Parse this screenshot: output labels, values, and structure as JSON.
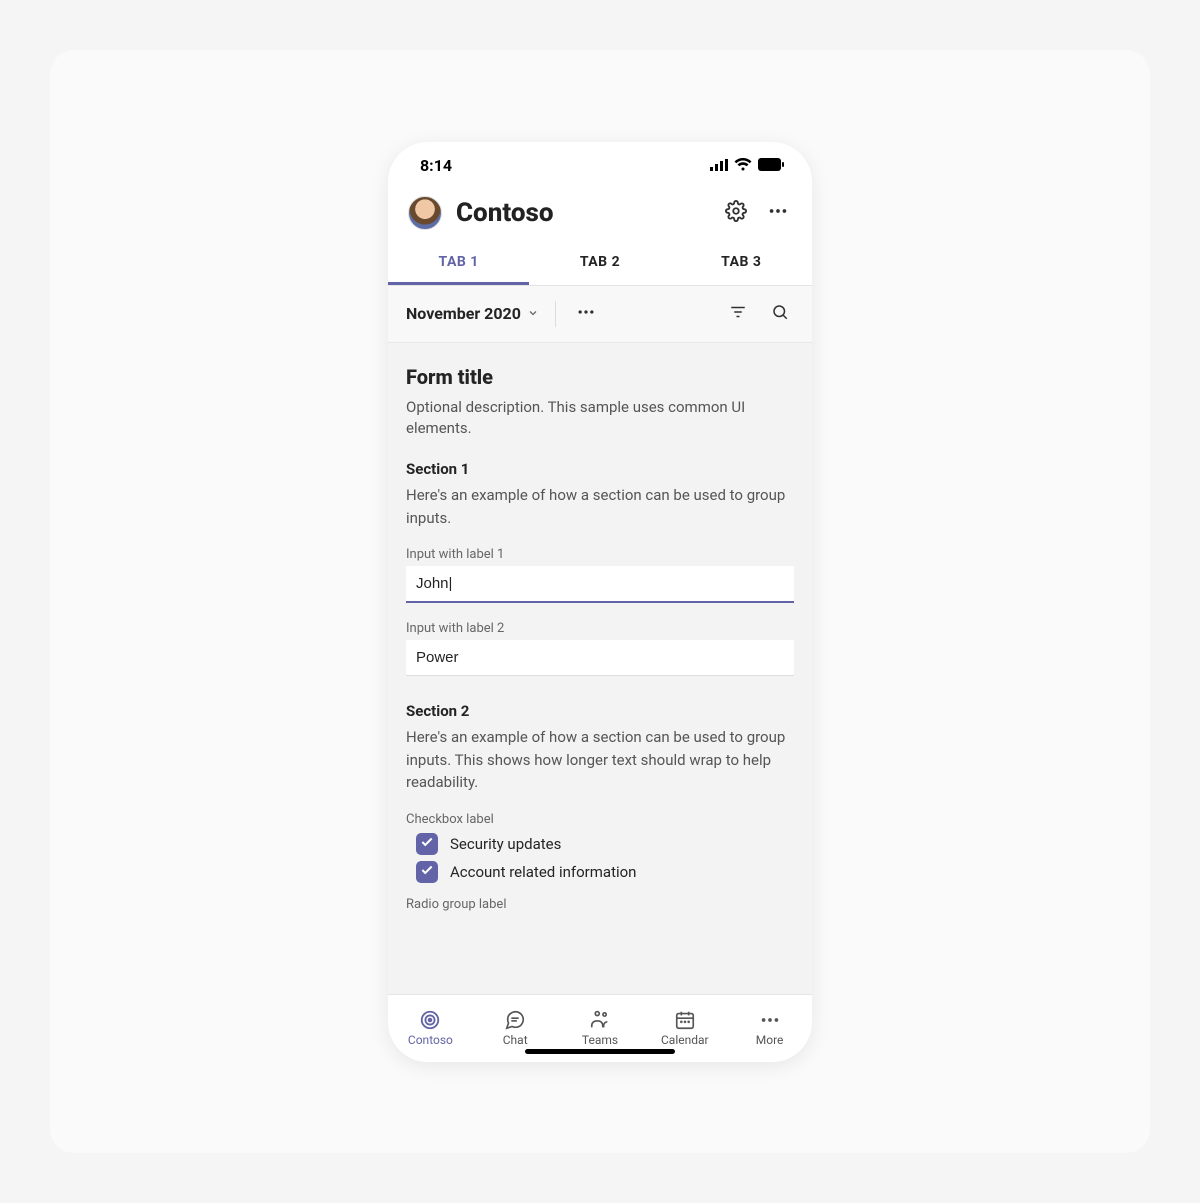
{
  "status": {
    "time": "8:14"
  },
  "header": {
    "app_title": "Contoso"
  },
  "tabs": [
    "TAB 1",
    "TAB 2",
    "TAB 3"
  ],
  "subheader": {
    "month": "November 2020"
  },
  "form": {
    "title": "Form title",
    "description": "Optional description. This sample uses common UI elements.",
    "section1": {
      "title": "Section 1",
      "description": "Here's an example of how a section can be used to group inputs.",
      "input1_label": "Input with label 1",
      "input1_value": "John|",
      "input2_label": "Input with label 2",
      "input2_value": "Power"
    },
    "section2": {
      "title": "Section 2",
      "description": "Here's an example of how a section can be used to group inputs. This shows how longer text should wrap to help readability.",
      "checkbox_group_label": "Checkbox label",
      "checkbox1": "Security updates",
      "checkbox2": "Account related information",
      "radio_group_label": "Radio group label"
    }
  },
  "nav": {
    "items": [
      {
        "label": "Contoso"
      },
      {
        "label": "Chat"
      },
      {
        "label": "Teams"
      },
      {
        "label": "Calendar"
      },
      {
        "label": "More"
      }
    ]
  }
}
